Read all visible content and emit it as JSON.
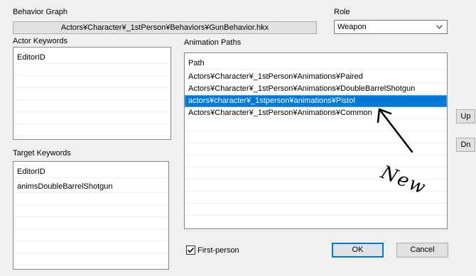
{
  "behavior_graph": {
    "label": "Behavior Graph",
    "value": "Actors¥Character¥_1stPerson¥Behaviors¥GunBehavior.hkx"
  },
  "role": {
    "label": "Role",
    "selected": "Weapon",
    "icon": "chevron-down-icon"
  },
  "actor_keywords": {
    "label": "Actor Keywords",
    "items": [
      "EditorID"
    ]
  },
  "target_keywords": {
    "label": "Target Keywords",
    "items": [
      "EditorID",
      "animsDoubleBarrelShotgun"
    ]
  },
  "animation_paths": {
    "label": "Animation Paths",
    "rows": [
      "Path",
      "Actors¥Character¥_1stPerson¥Animations¥Paired",
      "Actors¥Character¥_1stPerson¥Animations¥DoubleBarrelShotgun",
      "actors¥character¥_1stperson¥animations¥Pistol",
      "Actors¥Character¥_1stPerson¥Animations¥Common"
    ],
    "selected_index": 3
  },
  "side_buttons": {
    "up": "Up",
    "down": "Dn"
  },
  "first_person": {
    "label": "First-person",
    "checked": true
  },
  "footer": {
    "ok": "OK",
    "cancel": "Cancel"
  },
  "annotation": {
    "text": "New",
    "color": "#000000"
  },
  "colors": {
    "selection": "#0078d7",
    "window": "#f0f0f0"
  }
}
